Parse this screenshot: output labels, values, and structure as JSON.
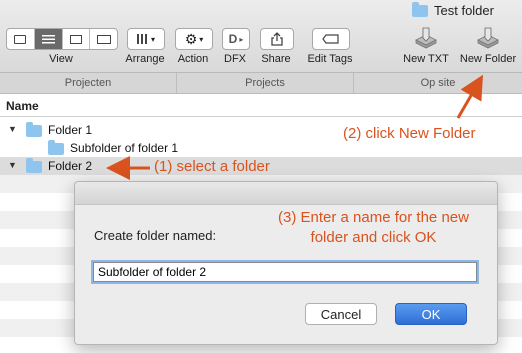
{
  "window": {
    "title": "Test folder",
    "title_icon": "folder-icon"
  },
  "toolbar": {
    "view_label": "View",
    "arrange_label": "Arrange",
    "action_label": "Action",
    "dfx_label": "DFX",
    "share_label": "Share",
    "edit_tags_label": "Edit Tags",
    "new_txt_label": "New TXT",
    "new_folder_label": "New Folder",
    "dfx_button_text": "D"
  },
  "groups": [
    "Projecten",
    "Projects",
    "Op site"
  ],
  "list": {
    "column_name": "Name",
    "rows": [
      {
        "label": "Folder 1"
      },
      {
        "label": "Subfolder of folder 1"
      },
      {
        "label": "Folder 2"
      }
    ]
  },
  "annotations": {
    "step1": "(1) select a folder",
    "step2": "(2) click New Folder",
    "step3_line1": "(3) Enter a name for the new",
    "step3_line2": "folder and click OK",
    "color": "#d9531e"
  },
  "dialog": {
    "prompt": "Create folder named:",
    "input_value": "Subfolder of folder 2",
    "cancel_label": "Cancel",
    "ok_label": "OK",
    "ok_color": "#2f6fd6"
  }
}
